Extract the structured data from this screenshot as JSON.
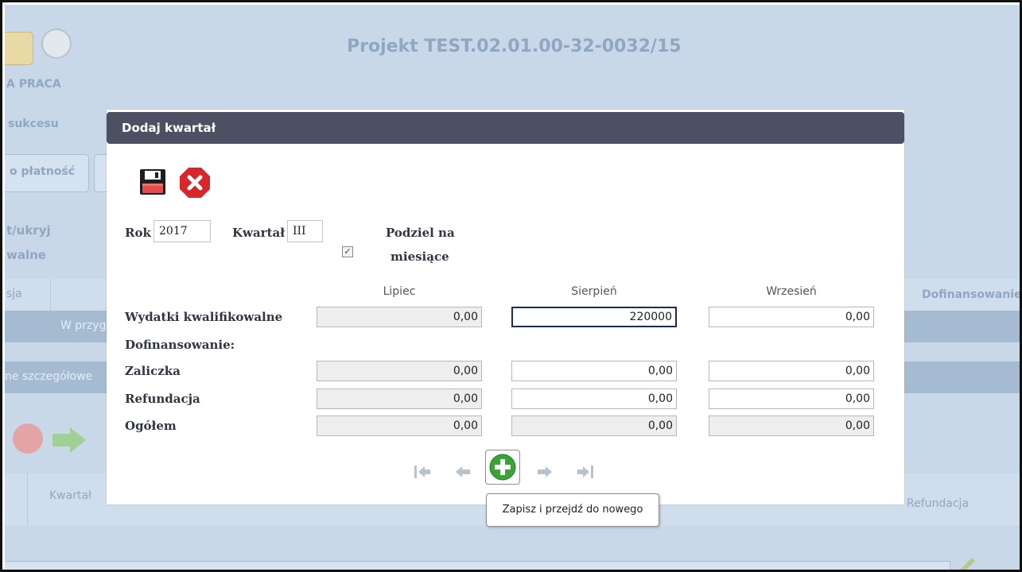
{
  "background": {
    "project_title": "Projekt TEST.02.01.00-32-0032/15",
    "frag_praca": "A PRACA",
    "frag_sukcesu": "sukcesu",
    "frag_platnosc": "o płatność",
    "frag_ukryj": "t/ukryj",
    "frag_walne": "walne",
    "frag_sja": "sja",
    "frag_dofinansowanie": "Dofinansowanie",
    "frag_w_przyg": "W przyg",
    "frag_szczegolowe": "ne szczegółowe",
    "frag_kwartal": "Kwartał",
    "frag_refundacja": "Refundacja"
  },
  "modal": {
    "title": "Dodaj kwartał",
    "rok_label": "Rok",
    "rok_value": "2017",
    "kwartal_label": "Kwartał",
    "kwartal_value": "III",
    "podziel_label_1": "Podziel na",
    "podziel_label_2": "miesiące",
    "podziel_checked": true,
    "columns": [
      "Lipiec",
      "Sierpień",
      "Wrzesień"
    ],
    "rows": {
      "wydatki": {
        "label": "Wydatki kwalifikowalne",
        "values": [
          "0,00",
          "220000",
          "0,00"
        ]
      },
      "dofinansowanie": {
        "label": "Dofinansowanie:"
      },
      "zaliczka": {
        "label": "Zaliczka",
        "values": [
          "0,00",
          "0,00",
          "0,00"
        ]
      },
      "refundacja": {
        "label": "Refundacja",
        "values": [
          "0,00",
          "0,00",
          "0,00"
        ]
      },
      "ogolem": {
        "label": "Ogółem",
        "values": [
          "0,00",
          "0,00",
          "0,00"
        ]
      }
    },
    "tooltip": "Zapisz i przejdź do nowego"
  },
  "colors": {
    "header_bg": "#4c5062",
    "background_blue": "#c9d8e8",
    "add_green": "#3aa335",
    "cancel_red": "#d9262b"
  }
}
